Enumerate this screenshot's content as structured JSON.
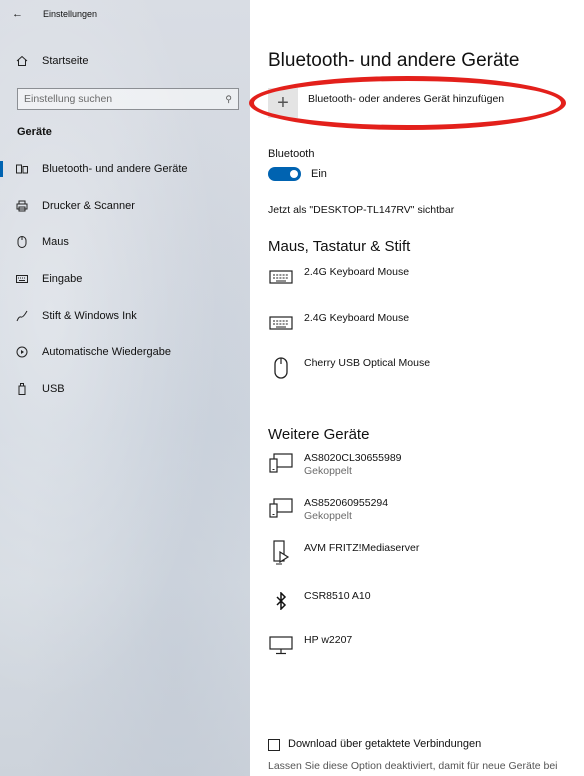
{
  "window": {
    "back_icon": "back-arrow-icon",
    "title": "Einstellungen"
  },
  "sidebar": {
    "home_label": "Startseite",
    "search_placeholder": "Einstellung suchen",
    "section_label": "Geräte",
    "items": [
      {
        "label": "Bluetooth- und andere Geräte",
        "icon": "bluetooth-devices-icon",
        "active": true
      },
      {
        "label": "Drucker & Scanner",
        "icon": "printer-icon",
        "active": false
      },
      {
        "label": "Maus",
        "icon": "mouse-icon",
        "active": false
      },
      {
        "label": "Eingabe",
        "icon": "keyboard-icon",
        "active": false
      },
      {
        "label": "Stift & Windows Ink",
        "icon": "pen-icon",
        "active": false
      },
      {
        "label": "Automatische Wiedergabe",
        "icon": "autoplay-icon",
        "active": false
      },
      {
        "label": "USB",
        "icon": "usb-icon",
        "active": false
      }
    ]
  },
  "main": {
    "title": "Bluetooth- und andere Geräte",
    "add_device_label": "Bluetooth- oder anderes Gerät hinzufügen",
    "bluetooth_label": "Bluetooth",
    "bluetooth_toggle": {
      "state": "Ein",
      "on": true
    },
    "visible_as": "Jetzt als \"DESKTOP-TL147RV\" sichtbar",
    "mouse_section_title": "Maus, Tastatur & Stift",
    "mouse_devices": [
      {
        "name": "2.4G Keyboard Mouse",
        "icon": "keyboard-icon"
      },
      {
        "name": "2.4G Keyboard Mouse",
        "icon": "keyboard-icon"
      },
      {
        "name": "Cherry USB Optical Mouse",
        "icon": "mouse-icon"
      }
    ],
    "other_section_title": "Weitere Geräte",
    "other_devices": [
      {
        "name": "AS8020CL30655989",
        "status": "Gekoppelt",
        "icon": "phone-tablet-icon"
      },
      {
        "name": "AS852060955294",
        "status": "Gekoppelt",
        "icon": "phone-tablet-icon"
      },
      {
        "name": "AVM FRITZ!Mediaserver",
        "status": "",
        "icon": "media-server-icon"
      },
      {
        "name": "CSR8510 A10",
        "status": "",
        "icon": "bluetooth-icon"
      },
      {
        "name": "HP w2207",
        "status": "",
        "icon": "monitor-icon"
      }
    ],
    "metered_checkbox_label": "Download über getaktete Verbindungen",
    "metered_note": "Lassen Sie diese Option deaktiviert, damit für neue Geräte bei"
  },
  "colors": {
    "accent": "#0063b1",
    "highlight_circle": "#e3201b"
  }
}
